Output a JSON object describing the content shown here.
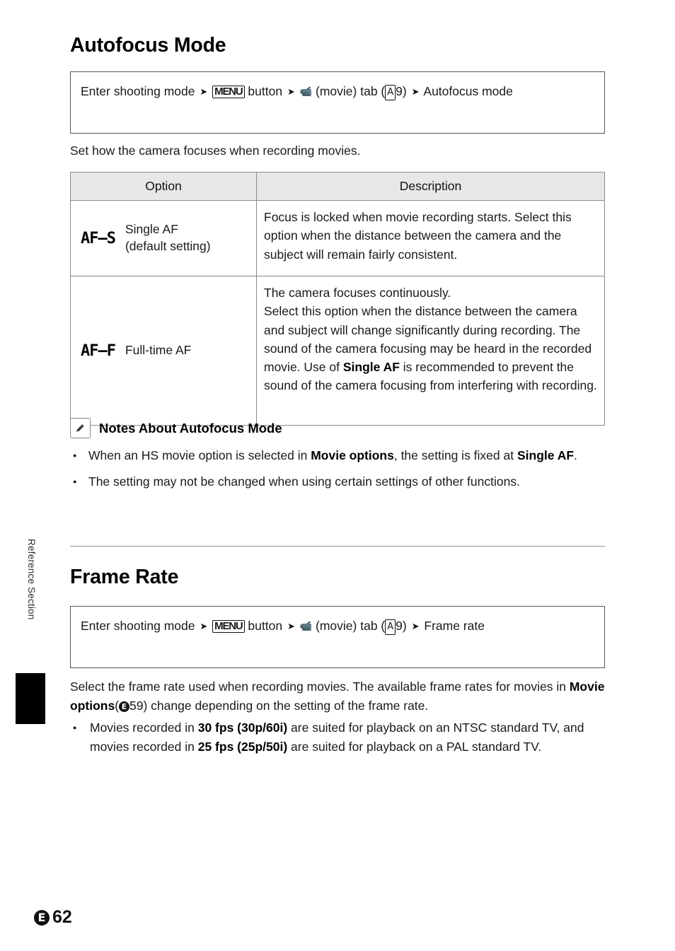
{
  "page": {
    "side_label": "Reference Section",
    "footer_badge": "E",
    "footer_number": "62"
  },
  "autofocus": {
    "title": "Autofocus Mode",
    "nav": {
      "part1": "Enter shooting mode",
      "menu_label": "MENU",
      "part2": "button",
      "movie_icon": "🎥",
      "part3": "(movie) tab (",
      "book_icon": "A",
      "page_ref": "9)",
      "part4": "Autofocus mode",
      "arrow": "➔"
    },
    "intro": "Set how the camera focuses when recording movies.",
    "table": {
      "headers": [
        "Option",
        "Description"
      ],
      "rows": [
        {
          "icon": "AF–S",
          "label_line1": "Single AF",
          "label_line2": "(default setting)",
          "description": "Focus is locked when movie recording starts. Select this option when the distance between the camera and the subject will remain fairly consistent."
        },
        {
          "icon": "AF–F",
          "label_line1": "Full-time AF",
          "label_line2": "",
          "description_pre": "The camera focuses continuously.\nSelect this option when the distance between the camera and subject will change significantly during recording. The sound of the camera focusing may be heard in the recorded movie. Use of ",
          "description_bold": "Single AF",
          "description_post": " is recommended to prevent the sound of the camera focusing from interfering with recording."
        }
      ]
    },
    "notes": {
      "heading": "Notes About Autofocus Mode",
      "items": [
        {
          "pre": "When an HS movie option is selected in ",
          "bold1": "Movie options",
          "mid": ", the setting is fixed at ",
          "bold2": "Single AF",
          "post": "."
        },
        {
          "pre": "The setting may not be changed when using certain settings of other functions.",
          "bold1": "",
          "mid": "",
          "bold2": "",
          "post": ""
        }
      ]
    }
  },
  "framerate": {
    "title": "Frame Rate",
    "nav": {
      "part1": "Enter shooting mode",
      "menu_label": "MENU",
      "part2": "button",
      "part3": "(movie) tab (",
      "book_icon": "A",
      "page_ref": "9)",
      "part4": "Frame rate",
      "arrow": "➔"
    },
    "intro_pre": "Select the frame rate used when recording movies. The available frame rates for movies in ",
    "intro_bold": "Movie options",
    "intro_ref_badge": "E",
    "intro_ref_num": "59",
    "intro_post": ") change depending on the setting of the frame rate.",
    "bullet": {
      "pre": "Movies recorded in ",
      "bold1": "30 fps (30p/60i)",
      "mid": " are suited for playback on an NTSC standard TV, and movies recorded in ",
      "bold2": "25 fps (25p/50i)",
      "post": " are suited for playback on a PAL standard TV."
    }
  }
}
